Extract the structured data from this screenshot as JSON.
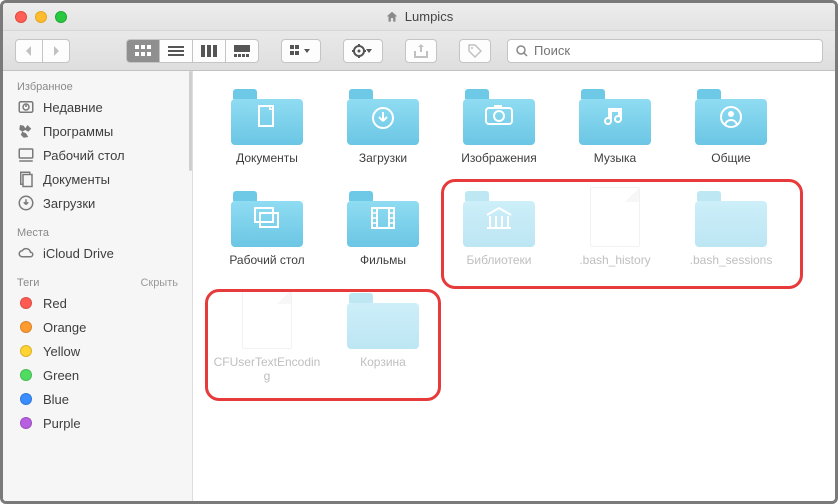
{
  "window": {
    "title": "Lumpics"
  },
  "search": {
    "placeholder": "Поиск"
  },
  "sidebar": {
    "favorites": {
      "heading": "Избранное",
      "items": [
        {
          "label": "Недавние",
          "icon": "clock"
        },
        {
          "label": "Программы",
          "icon": "apps"
        },
        {
          "label": "Рабочий стол",
          "icon": "desktop"
        },
        {
          "label": "Документы",
          "icon": "documents"
        },
        {
          "label": "Загрузки",
          "icon": "downloads"
        }
      ]
    },
    "locations": {
      "heading": "Места",
      "items": [
        {
          "label": "iCloud Drive",
          "icon": "cloud"
        }
      ]
    },
    "tags": {
      "heading": "Теги",
      "hide": "Скрыть",
      "items": [
        {
          "label": "Red",
          "color": "#ff5b52"
        },
        {
          "label": "Orange",
          "color": "#ff9b2f"
        },
        {
          "label": "Yellow",
          "color": "#ffd332"
        },
        {
          "label": "Green",
          "color": "#4fdc60"
        },
        {
          "label": "Blue",
          "color": "#3a8dff"
        },
        {
          "label": "Purple",
          "color": "#b75fe0"
        }
      ]
    }
  },
  "folders": {
    "row1": [
      {
        "label": "Документы",
        "glyph": "doc"
      },
      {
        "label": "Загрузки",
        "glyph": "download"
      },
      {
        "label": "Изображения",
        "glyph": "camera"
      },
      {
        "label": "Музыка",
        "glyph": "music"
      },
      {
        "label": "Общие",
        "glyph": "person"
      }
    ],
    "row2": [
      {
        "label": "Рабочий стол",
        "glyph": "windows"
      },
      {
        "label": "Фильмы",
        "glyph": "film"
      },
      {
        "label": "Библиотеки",
        "glyph": "library",
        "dim": true
      },
      {
        "label": ".bash_history",
        "type": "file",
        "dim": true
      },
      {
        "label": ".bash_sessions",
        "dim": true
      }
    ],
    "row3": [
      {
        "label": "CFUserTextEncoding",
        "type": "file",
        "dim": true
      },
      {
        "label": "Корзина",
        "dim": true
      }
    ]
  },
  "colors": {
    "folder_light": "#8fdcf2",
    "folder_top": "#6ec9e6"
  }
}
